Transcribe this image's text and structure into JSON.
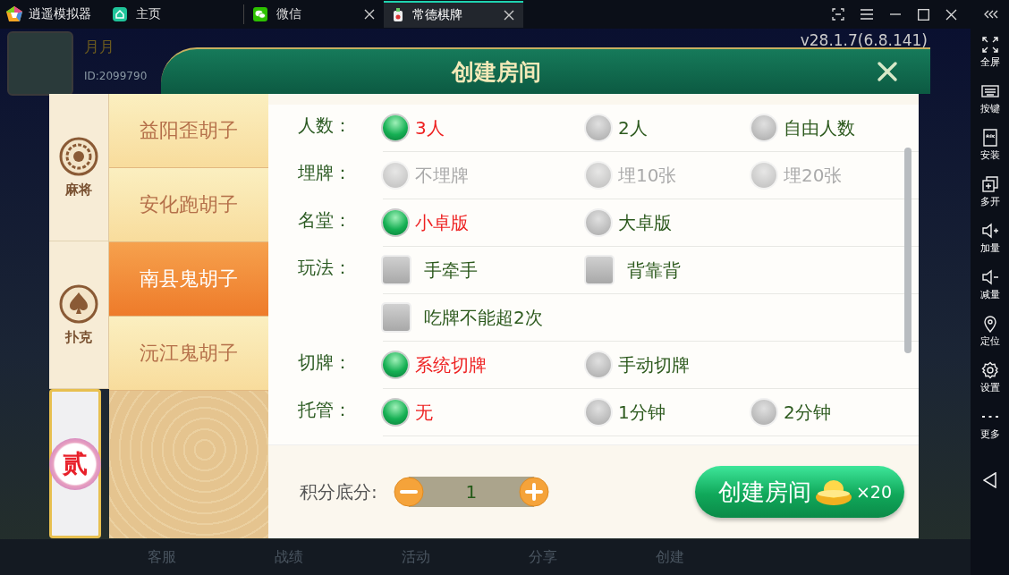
{
  "emulator": {
    "title": "逍遥模拟器",
    "tabs": [
      {
        "label": "主页",
        "kind": "home",
        "selected": false,
        "closable": false
      },
      {
        "label": "微信",
        "kind": "chat",
        "selected": false,
        "closable": true
      },
      {
        "label": "常德棋牌",
        "kind": "game",
        "selected": true,
        "closable": true
      }
    ],
    "sidebar": [
      {
        "label": "全屏",
        "kind": "fullscreen"
      },
      {
        "label": "按键",
        "kind": "keyboard"
      },
      {
        "label": "安装",
        "kind": "apk"
      },
      {
        "label": "多开",
        "kind": "multi"
      },
      {
        "label": "加量",
        "kind": "volup"
      },
      {
        "label": "减量",
        "kind": "voldown"
      },
      {
        "label": "定位",
        "kind": "location"
      },
      {
        "label": "设置",
        "kind": "settings"
      },
      {
        "label": "更多",
        "kind": "more"
      }
    ]
  },
  "game": {
    "player_name": "月月",
    "player_id": "ID:2099790",
    "version": "v28.1.7(6.8.141)",
    "bottom_menu": [
      "客服",
      "战绩",
      "活动",
      "分享",
      "创建"
    ]
  },
  "dialog": {
    "title": "创建房间",
    "categories": [
      {
        "label": "麻将",
        "kind": "mahjong",
        "selected": false
      },
      {
        "label": "扑克",
        "kind": "poker",
        "selected": false
      },
      {
        "label": "贰",
        "kind": "badge",
        "selected": true
      }
    ],
    "games": [
      {
        "label": "益阳歪胡子",
        "selected": false
      },
      {
        "label": "安化跑胡子",
        "selected": false
      },
      {
        "label": "南县鬼胡子",
        "selected": true
      },
      {
        "label": "沅江鬼胡子",
        "selected": false
      }
    ],
    "options": [
      {
        "label": "人数：",
        "kind": "radio",
        "disabled": false,
        "lines": [
          [
            {
              "label": "3人",
              "selected": true
            },
            {
              "label": "2人",
              "selected": false
            },
            {
              "label": "自由人数",
              "selected": false
            }
          ]
        ]
      },
      {
        "label": "埋牌：",
        "kind": "radio",
        "disabled": true,
        "lines": [
          [
            {
              "label": "不埋牌",
              "selected": false
            },
            {
              "label": "埋10张",
              "selected": false
            },
            {
              "label": "埋20张",
              "selected": false
            }
          ]
        ]
      },
      {
        "label": "名堂：",
        "kind": "radio",
        "disabled": false,
        "lines": [
          [
            {
              "label": "小卓版",
              "selected": true
            },
            {
              "label": "大卓版",
              "selected": false
            }
          ]
        ]
      },
      {
        "label": "玩法：",
        "kind": "checkbox",
        "disabled": false,
        "lines": [
          [
            {
              "label": "手牵手",
              "selected": false
            },
            {
              "label": "背靠背",
              "selected": false
            }
          ],
          [
            {
              "label": "吃牌不能超2次",
              "selected": false
            }
          ]
        ]
      },
      {
        "label": "切牌：",
        "kind": "radio",
        "disabled": false,
        "lines": [
          [
            {
              "label": "系统切牌",
              "selected": true
            },
            {
              "label": "手动切牌",
              "selected": false
            }
          ]
        ]
      },
      {
        "label": "托管：",
        "kind": "radio",
        "disabled": false,
        "lines": [
          [
            {
              "label": "无",
              "selected": true
            },
            {
              "label": "1分钟",
              "selected": false
            },
            {
              "label": "2分钟",
              "selected": false
            }
          ]
        ]
      }
    ],
    "score": {
      "label": "积分底分:",
      "value": "1"
    },
    "create_button": {
      "label": "创建房间",
      "cost": "×20"
    }
  }
}
